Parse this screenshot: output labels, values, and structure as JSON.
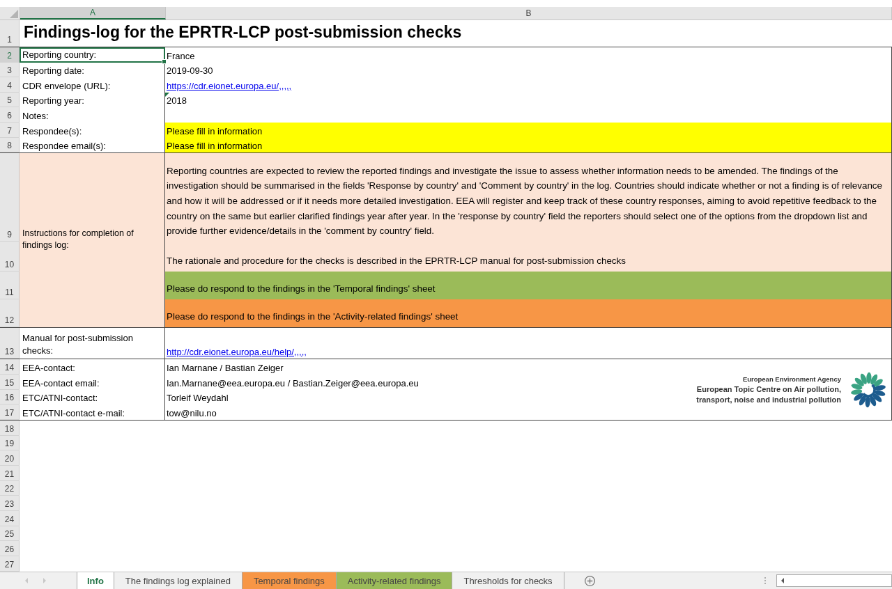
{
  "columns": [
    {
      "label": "A",
      "selected": true
    },
    {
      "label": "B",
      "selected": false
    }
  ],
  "title_row": {
    "number": "1",
    "text": "Findings-log for the EPRTR-LCP post-submission checks"
  },
  "info_rows": [
    {
      "number": "2",
      "label": "Reporting country:",
      "value": "France",
      "kind": "text",
      "selected": true,
      "flagged": false
    },
    {
      "number": "3",
      "label": "Reporting date:",
      "value": "2019-09-30",
      "kind": "text",
      "selected": false,
      "flagged": false
    },
    {
      "number": "4",
      "label": "CDR envelope (URL):",
      "value": "https://cdr.eionet.europa.eu/,,,,,",
      "kind": "link",
      "selected": false,
      "flagged": false
    },
    {
      "number": "5",
      "label": "Reporting year:",
      "value": "2018",
      "kind": "text",
      "selected": false,
      "flagged": true
    },
    {
      "number": "6",
      "label": "Notes:",
      "kind": "text",
      "selected": false,
      "flagged": false
    },
    {
      "number": "7",
      "label": "Respondee(s):",
      "value": "Please fill in information",
      "kind": "text",
      "color": "#ffff00",
      "selected": false,
      "flagged": false
    },
    {
      "number": "8",
      "label": "Respondee email(s):",
      "value": "Please fill in information",
      "kind": "text",
      "color": "#ffff00",
      "selected": false,
      "flagged": false
    }
  ],
  "instructions": {
    "label": "Instructions for completion of findings log:",
    "color": "#fce4d6",
    "rows": [
      {
        "number": "9",
        "text": "Reporting countries are expected to review the reported findings and investigate the issue to assess whether information needs to be amended. The findings of the investigation should be summarised in the fields 'Response by country' and 'Comment by country' in the log.  Countries should indicate whether or not a finding is of relevance and how it will be addressed or if it needs more detailed investigation. EEA will register and keep track of these country responses, aiming to avoid repetitive feedback to the country on the same but earlier clarified findings year after year. In the 'response by country' field the reporters should select one of the options from the dropdown list and provide further evidence/details in the 'comment by country' field.",
        "color": "#fce4d6"
      },
      {
        "number": "10",
        "text": "The rationale and procedure for the checks is described in the EPRTR-LCP manual for post-submission checks",
        "color": "#fce4d6"
      },
      {
        "number": "11",
        "text": "Please do respond to the findings in the 'Temporal findings' sheet",
        "color": "#9bbb59"
      },
      {
        "number": "12",
        "text": "Please do respond to the findings in the 'Activity-related findings' sheet",
        "color": "#f79646"
      }
    ]
  },
  "manual_row": {
    "number": "13",
    "label": "Manual for post-submission checks:",
    "value": "http://cdr.eionet.europa.eu/help/,,,,,"
  },
  "contact_rows": [
    {
      "number": "14",
      "label": "EEA-contact:",
      "value": "Ian Marnane / Bastian Zeiger"
    },
    {
      "number": "15",
      "label": "EEA-contact email:",
      "value": "Ian.Marnane@eea.europa.eu / Bastian.Zeiger@eea.europa.eu"
    },
    {
      "number": "16",
      "label": "ETC/ATNI-contact:",
      "value": "Torleif Weydahl"
    },
    {
      "number": "17",
      "label": "ETC/ATNI-contact e-mail:",
      "value": "tow@nilu.no"
    }
  ],
  "logo": {
    "agency": "European Environment Agency",
    "centre": "European Topic Centre on Air pollution,",
    "centre_2": "transport, noise and industrial pollution"
  },
  "empty_rows": [
    "18",
    "19",
    "20",
    "21",
    "22",
    "23",
    "24",
    "25",
    "26",
    "27"
  ],
  "tabs": [
    {
      "label": "Info",
      "selected": true
    },
    {
      "label": "The findings log explained",
      "selected": false
    },
    {
      "label": "Temporal findings",
      "selected": false,
      "color": "#f79646"
    },
    {
      "label": "Activity-related findings",
      "selected": false,
      "color": "#9bbb59"
    },
    {
      "label": "Thresholds for checks",
      "selected": false
    }
  ]
}
